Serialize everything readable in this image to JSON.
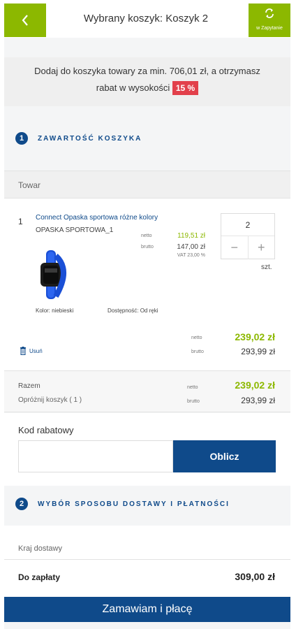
{
  "header": {
    "back_icon": "chevron-left-icon",
    "title": "Wybrany koszyk: Koszyk 2",
    "query_icon": "refresh-arrows-icon",
    "query_label": "w Zapytanie"
  },
  "promo": {
    "text_line1": "Dodaj do koszyka towary za min. 706,01 zł, a otrzymasz",
    "text_line2": "rabat w wysokości",
    "badge": "15 %"
  },
  "colors": {
    "accent_green": "#8cb800",
    "primary_blue": "#0f4a8a",
    "badge_red": "#e2404b"
  },
  "section1": {
    "number": "1",
    "title": "ZAWARTOŚĆ KOSZYKA",
    "column_header": "Towar"
  },
  "item": {
    "position": "1",
    "name": "Connect Opaska sportowa różne kolory",
    "code": "OPASKA SPORTOWA_1",
    "net_label": "netto",
    "gross_label": "brutto",
    "unit_net": "119,51 zł",
    "unit_gross": "147,00 zł",
    "vat": "VAT 23,00 %",
    "quantity": "2",
    "minus": "−",
    "plus": "+",
    "unit": "szt.",
    "color_attr": "Kolor: niebieski",
    "availability": "Dostępność: Od ręki",
    "remove_label": "Usuń",
    "line_net": "239,02 zł",
    "line_gross": "293,99 zł"
  },
  "summary": {
    "total_label": "Razem",
    "clear_label": "Opróżnij koszyk ( 1 )",
    "net_label": "netto",
    "gross_label": "brutto",
    "total_net": "239,02 zł",
    "total_gross": "293,99 zł"
  },
  "coupon": {
    "label": "Kod rabatowy",
    "value": "",
    "button": "Oblicz"
  },
  "section2": {
    "number": "2",
    "title": "WYBÓR SPOSOBU DOSTAWY I PŁATNOŚCI",
    "country_label": "Kraj dostawy"
  },
  "footer": {
    "to_pay_label": "Do zapłaty",
    "to_pay_value": "309,00 zł",
    "order_button": "Zamawiam i płacę"
  }
}
